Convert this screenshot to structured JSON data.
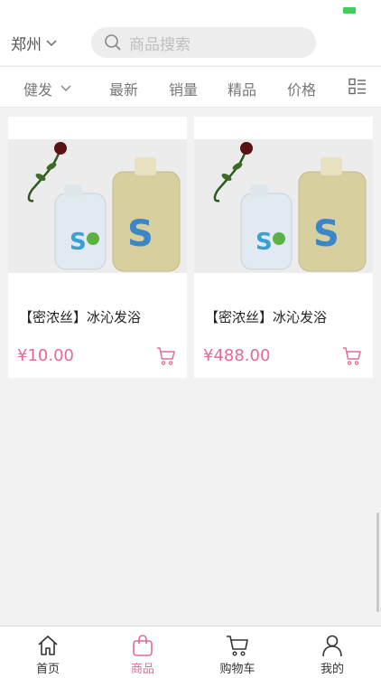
{
  "header": {
    "city": "郑州",
    "search_placeholder": "商品搜索"
  },
  "filters": [
    {
      "label": "健发"
    },
    {
      "label": "最新"
    },
    {
      "label": "销量"
    },
    {
      "label": "精品"
    },
    {
      "label": "价格"
    }
  ],
  "products": [
    {
      "title": "【密浓丝】冰沁发浴",
      "price": "¥10.00"
    },
    {
      "title": "【密浓丝】冰沁发浴",
      "price": "¥488.00"
    }
  ],
  "tabs": [
    {
      "label": "首页",
      "icon": "home-icon"
    },
    {
      "label": "商品",
      "icon": "shopping-bag-icon"
    },
    {
      "label": "购物车",
      "icon": "cart-icon"
    },
    {
      "label": "我的",
      "icon": "user-icon"
    }
  ],
  "colors": {
    "accent": "#e5689a",
    "battery": "#3ecf5b"
  }
}
